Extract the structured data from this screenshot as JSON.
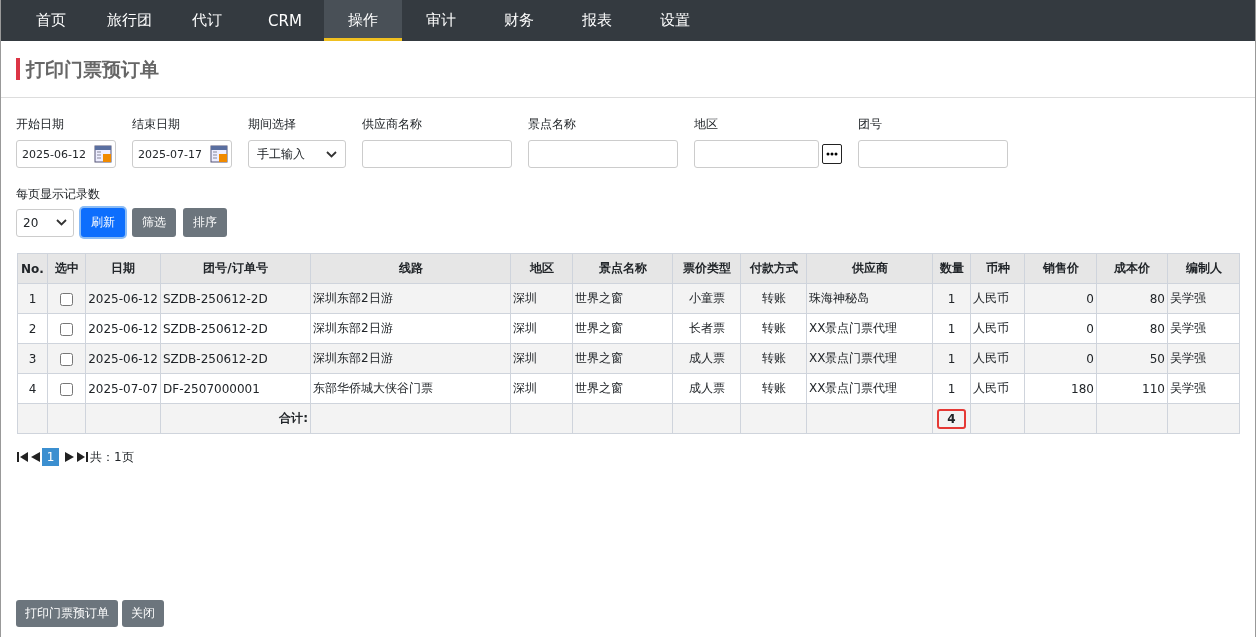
{
  "nav": [
    {
      "label": "首页",
      "selected": false
    },
    {
      "label": "旅行团",
      "selected": false
    },
    {
      "label": "代订",
      "selected": false
    },
    {
      "label": "CRM",
      "selected": false
    },
    {
      "label": "操作",
      "selected": true
    },
    {
      "label": "审计",
      "selected": false
    },
    {
      "label": "财务",
      "selected": false
    },
    {
      "label": "报表",
      "selected": false
    },
    {
      "label": "设置",
      "selected": false
    }
  ],
  "page_title": "打印门票预订单",
  "filters": [
    {
      "kind": "date",
      "label": "开始日期",
      "value": "2025-06-12"
    },
    {
      "kind": "date",
      "label": "结束日期",
      "value": "2025-07-17"
    },
    {
      "kind": "select",
      "label": "期间选择",
      "value": "手工输入"
    },
    {
      "kind": "text",
      "label": "供应商名称"
    },
    {
      "kind": "text",
      "label": "景点名称"
    },
    {
      "kind": "picker",
      "label": "地区"
    },
    {
      "kind": "text",
      "label": "团号"
    }
  ],
  "page_size": {
    "label": "每页显示记录数",
    "value": "20"
  },
  "actions": [
    {
      "label": "刷新",
      "primary": true
    },
    {
      "label": "筛选",
      "primary": false
    },
    {
      "label": "排序",
      "primary": false
    }
  ],
  "table": {
    "columns": [
      "No.",
      "选中",
      "日期",
      "团号/订单号",
      "线路",
      "地区",
      "景点名称",
      "票价类型",
      "付款方式",
      "供应商",
      "数量",
      "币种",
      "销售价",
      "成本价",
      "编制人"
    ],
    "rows": [
      {
        "checked": false,
        "cells": [
          "1",
          "",
          "2025-06-12",
          "SZDB-250612-2D",
          "深圳东部2日游",
          "深圳",
          "世界之窗",
          "小童票",
          "转账",
          "珠海神秘岛",
          "1",
          "人民币",
          "0",
          "80",
          "吴学强"
        ]
      },
      {
        "checked": false,
        "cells": [
          "2",
          "",
          "2025-06-12",
          "SZDB-250612-2D",
          "深圳东部2日游",
          "深圳",
          "世界之窗",
          "长者票",
          "转账",
          "XX景点门票代理",
          "1",
          "人民币",
          "0",
          "80",
          "吴学强"
        ]
      },
      {
        "checked": false,
        "cells": [
          "3",
          "",
          "2025-06-12",
          "SZDB-250612-2D",
          "深圳东部2日游",
          "深圳",
          "世界之窗",
          "成人票",
          "转账",
          "XX景点门票代理",
          "1",
          "人民币",
          "0",
          "50",
          "吴学强"
        ]
      },
      {
        "checked": false,
        "cells": [
          "4",
          "",
          "2025-07-07",
          "DF-2507000001",
          "东部华侨城大侠谷门票",
          "深圳",
          "世界之窗",
          "成人票",
          "转账",
          "XX景点门票代理",
          "1",
          "人民币",
          "180",
          "110",
          "吴学强"
        ]
      }
    ],
    "total_label": "合计:",
    "total_quantity": "4",
    "total_highlighted": true
  },
  "pager": {
    "pages": [
      {
        "label": "1",
        "selected": true
      }
    ],
    "summary": "共：1页"
  },
  "footer_buttons": [
    "打印门票预订单",
    "关闭"
  ]
}
